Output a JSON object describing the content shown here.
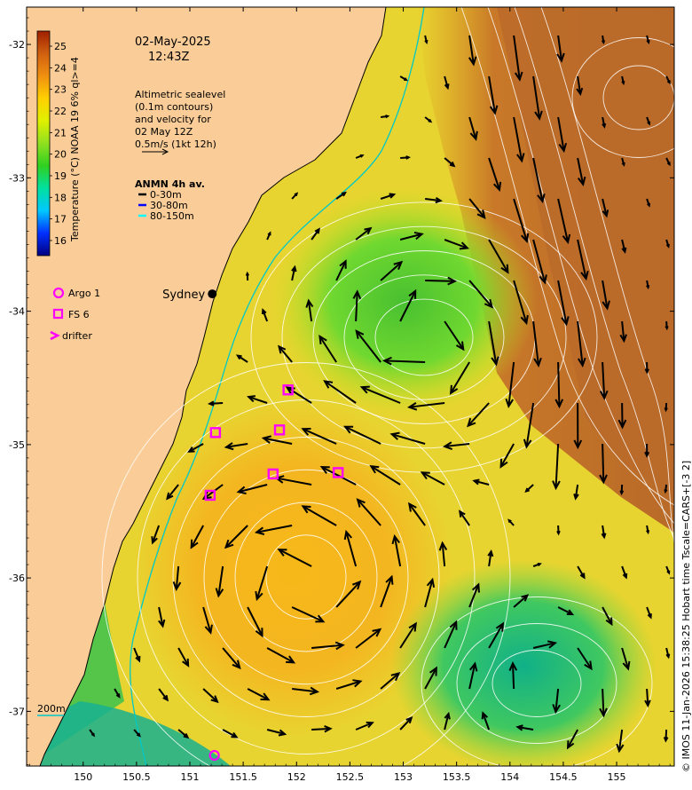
{
  "map": {
    "timestamp_date": "02-May-2025",
    "timestamp_time": "12:43Z",
    "altimetry_note": [
      "Altimetric sealevel",
      "(0.1m contours)",
      "and velocity for",
      "02 May 12Z",
      "0.5m/s (1kt 12h)"
    ],
    "anmn_title": "ANMN 4h av.",
    "anmn_entries": [
      {
        "label": "0-30m",
        "color": "#000000"
      },
      {
        "label": "30-80m",
        "color": "#0000ff"
      },
      {
        "label": "80-150m",
        "color": "#00ffff"
      }
    ],
    "platform_legend": [
      {
        "label": "Argo 1",
        "symbol": "circle"
      },
      {
        "label": "FS 6",
        "symbol": "square"
      },
      {
        "label": "drifter",
        "symbol": "chevron"
      }
    ],
    "place_label": "Sydney",
    "depth_label": "200m",
    "credit": "© IMOS 11-Jan-2026 15:38:25 Hobart time Tscale=CARS+[-3 2]",
    "colorbar": {
      "title": "Temperature (°C) NOAA 19 6% ql>=4",
      "ticks": [
        "25",
        "24",
        "23",
        "22",
        "21",
        "20",
        "19",
        "18",
        "17",
        "16"
      ],
      "min": 15.3,
      "max": 25.7,
      "colors": [
        "#000080",
        "#0030ff",
        "#00c8ff",
        "#00e0a0",
        "#30d020",
        "#90e020",
        "#e0f000",
        "#ffd000",
        "#f09010",
        "#d06010",
        "#a02000"
      ]
    },
    "x_ticks": [
      "150",
      "150.5",
      "151",
      "151.5",
      "152",
      "152.5",
      "153",
      "153.5",
      "154",
      "154.5",
      "155"
    ],
    "y_ticks": [
      "-32",
      "-33",
      "-34",
      "-35",
      "-36",
      "-37"
    ],
    "lon_range": [
      149.47,
      155.54
    ],
    "lat_range": [
      -37.41,
      -31.72
    ],
    "marker_color": "#ff00ff",
    "land_color": "#facd98",
    "contour_color": "#ffffff",
    "shelf_color": "#00c8c8",
    "fs_floats": [
      {
        "lon": 151.92,
        "lat": -34.59
      },
      {
        "lon": 151.24,
        "lat": -34.91
      },
      {
        "lon": 151.84,
        "lat": -34.89
      },
      {
        "lon": 151.78,
        "lat": -35.22
      },
      {
        "lon": 152.39,
        "lat": -35.21
      },
      {
        "lon": 151.19,
        "lat": -35.38
      }
    ],
    "argo_floats": [
      {
        "lon": 151.23,
        "lat": -37.33
      }
    ],
    "sydney": {
      "lon": 151.21,
      "lat": -33.87
    }
  }
}
